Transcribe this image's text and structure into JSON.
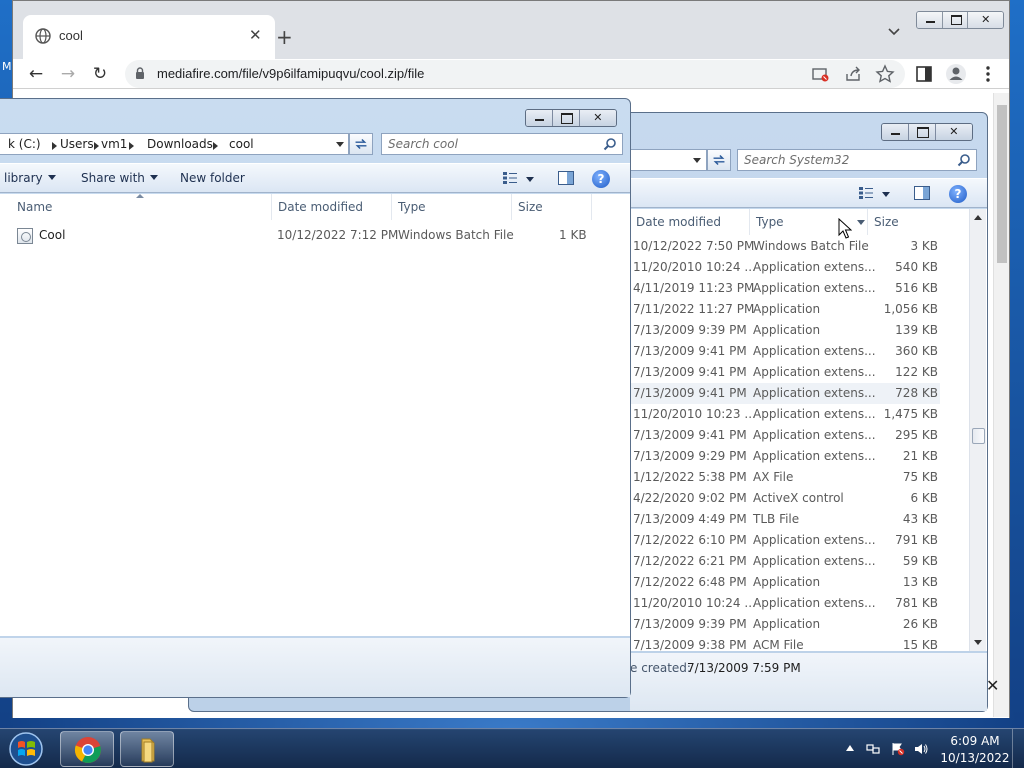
{
  "desktop": {
    "partial_label": "M"
  },
  "chrome": {
    "tab_title": "cool",
    "url": "mediafire.com/file/v9p6ilfamipuqvu/cool.zip/file",
    "icons": [
      "globe-icon",
      "close-icon",
      "plus-icon",
      "chevron-down-icon",
      "back-icon",
      "forward-icon",
      "reload-icon",
      "lock-icon",
      "blocked-popup-icon",
      "share-icon",
      "star-icon",
      "side-panel-icon",
      "profile-icon",
      "kebab-menu-icon"
    ]
  },
  "explorer_system32": {
    "search_placeholder": "Search System32",
    "columns": {
      "date": "Date modified",
      "type": "Type",
      "size": "Size"
    },
    "rows": [
      {
        "date": "10/12/2022 7:50 PM",
        "type": "Windows Batch File",
        "size": "3 KB"
      },
      {
        "date": "11/20/2010 10:24 ...",
        "type": "Application extens...",
        "size": "540 KB"
      },
      {
        "date": "4/11/2019 11:23 PM",
        "type": "Application extens...",
        "size": "516 KB"
      },
      {
        "date": "7/11/2022 11:27 PM",
        "type": "Application",
        "size": "1,056 KB"
      },
      {
        "date": "7/13/2009 9:39 PM",
        "type": "Application",
        "size": "139 KB"
      },
      {
        "date": "7/13/2009 9:41 PM",
        "type": "Application extens...",
        "size": "360 KB"
      },
      {
        "date": "7/13/2009 9:41 PM",
        "type": "Application extens...",
        "size": "122 KB"
      },
      {
        "date": "7/13/2009 9:41 PM",
        "type": "Application extens...",
        "size": "728 KB"
      },
      {
        "date": "11/20/2010 10:23 ...",
        "type": "Application extens...",
        "size": "1,475 KB"
      },
      {
        "date": "7/13/2009 9:41 PM",
        "type": "Application extens...",
        "size": "295 KB"
      },
      {
        "date": "7/13/2009 9:29 PM",
        "type": "Application extens...",
        "size": "21 KB"
      },
      {
        "date": "1/12/2022 5:38 PM",
        "type": "AX File",
        "size": "75 KB"
      },
      {
        "date": "4/22/2020 9:02 PM",
        "type": "ActiveX control",
        "size": "6 KB"
      },
      {
        "date": "7/13/2009 4:49 PM",
        "type": "TLB File",
        "size": "43 KB"
      },
      {
        "date": "7/12/2022 6:10 PM",
        "type": "Application extens...",
        "size": "791 KB"
      },
      {
        "date": "7/12/2022 6:21 PM",
        "type": "Application extens...",
        "size": "59 KB"
      },
      {
        "date": "7/12/2022 6:48 PM",
        "type": "Application",
        "size": "13 KB"
      },
      {
        "date": "11/20/2010 10:24 ...",
        "type": "Application extens...",
        "size": "781 KB"
      },
      {
        "date": "7/13/2009 9:39 PM",
        "type": "Application",
        "size": "26 KB"
      },
      {
        "date": "7/13/2009 9:38 PM",
        "type": "ACM File",
        "size": "15 KB"
      }
    ],
    "details_label": "e created:",
    "details_value": "7/13/2009 7:59 PM"
  },
  "explorer_cool": {
    "breadcrumb": [
      "k (C:)",
      "Users",
      "vm1",
      "Downloads",
      "cool"
    ],
    "search_placeholder": "Search cool",
    "commands": {
      "library": "library",
      "share_with": "Share with",
      "new_folder": "New folder"
    },
    "columns": {
      "name": "Name",
      "date": "Date modified",
      "type": "Type",
      "size": "Size"
    },
    "files": [
      {
        "name": "Cool",
        "date": "10/12/2022 7:12 PM",
        "type": "Windows Batch File",
        "size": "1 KB"
      }
    ]
  },
  "taskbar": {
    "time": "6:09 AM",
    "date": "10/13/2022",
    "icons": [
      "windows-start-icon",
      "chrome-icon",
      "explorer-folder-icon",
      "tray-up-arrow-icon",
      "network-icon",
      "flag-icon",
      "volume-icon"
    ]
  }
}
